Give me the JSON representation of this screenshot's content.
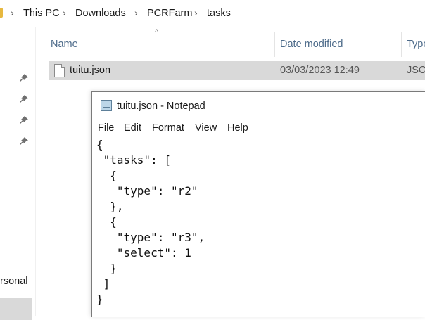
{
  "explorer": {
    "breadcrumbs": [
      "This PC",
      "Downloads",
      "PCRFarm",
      "tasks"
    ],
    "columns": {
      "name": "Name",
      "date_modified": "Date modified",
      "type": "Type"
    },
    "nav": {
      "personal_label": "rsonal"
    },
    "files": [
      {
        "name": "tuitu.json",
        "date": "03/03/2023 12:49",
        "type": "JSON"
      }
    ]
  },
  "notepad": {
    "title": "tuitu.json - Notepad",
    "menu": [
      "File",
      "Edit",
      "Format",
      "View",
      "Help"
    ],
    "content": "{\n \"tasks\": [\n  {\n   \"type\": \"r2\"\n  },\n  {\n   \"type\": \"r3\",\n   \"select\": 1\n  }\n ]\n}"
  }
}
